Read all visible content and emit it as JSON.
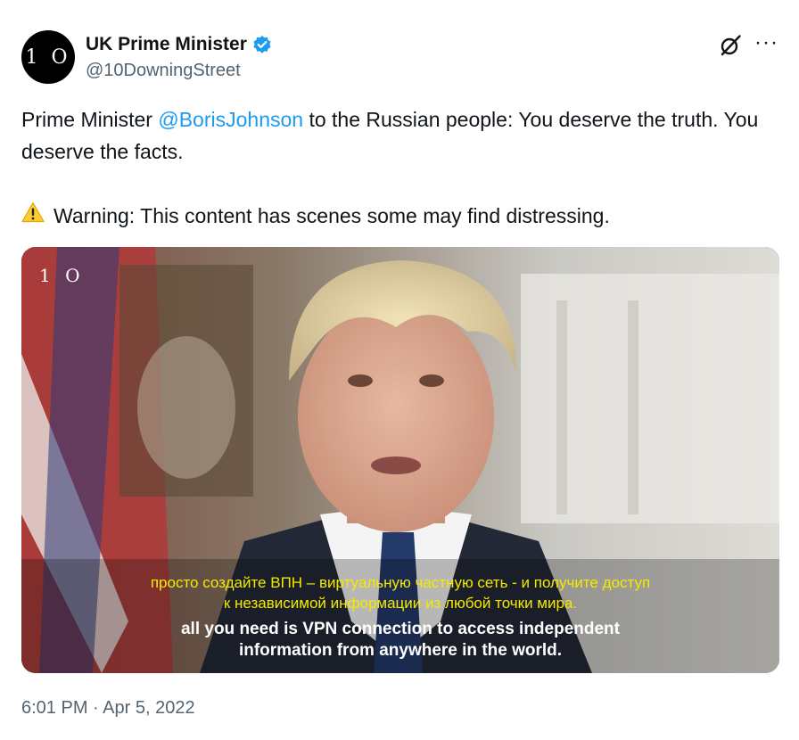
{
  "author": {
    "display_name": "UK Prime Minister",
    "handle": "@10DowningStreet",
    "avatar_text": "1 O",
    "verified_icon": "verified-badge-icon",
    "verified_color": "#1d9bf0"
  },
  "actions": {
    "grok_icon": "grok-icon",
    "more_label": "···"
  },
  "tweet": {
    "text_before_mention": "Prime Minister ",
    "mention": "@BorisJohnson",
    "text_after_mention": " to the Russian people: You deserve the truth. You deserve the facts.",
    "warning_icon": "warning-icon",
    "warning_text": "Warning: This content has scenes some may find distressing.",
    "mention_color": "#1d9bf0"
  },
  "media": {
    "logo_text": "1 O",
    "subtitle_ru_line1": "просто создайте ВПН – виртуальную частную сеть - и получите доступ",
    "subtitle_ru_line2": "к независимой информации из любой точки мира.",
    "subtitle_en_line1": "all you need is VPN connection to access independent",
    "subtitle_en_line2": "information from anywhere in the world."
  },
  "timestamp": "6:01 PM · Apr 5, 2022"
}
